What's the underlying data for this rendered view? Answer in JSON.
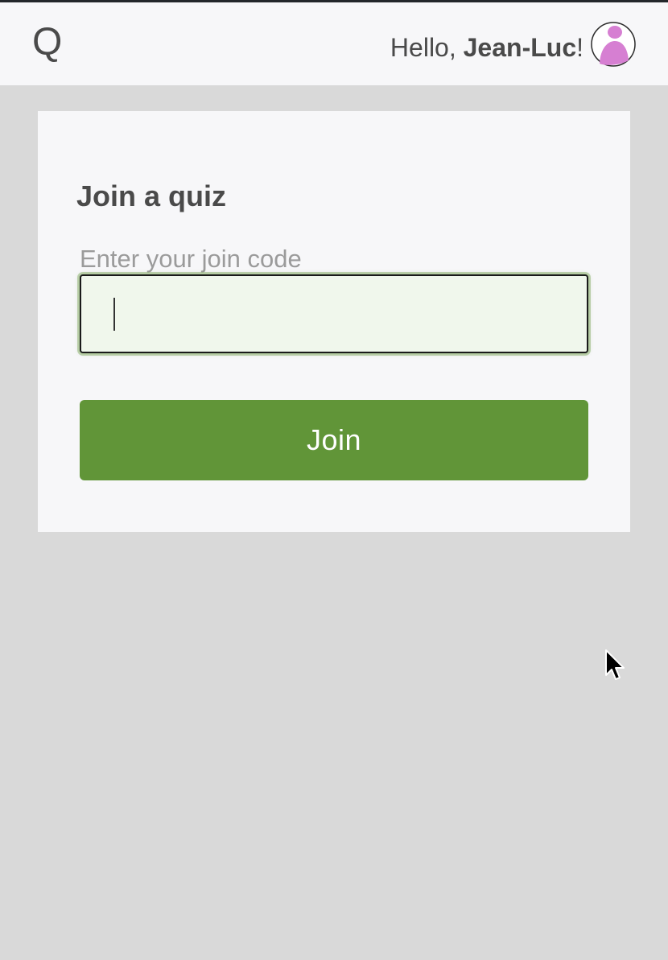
{
  "header": {
    "logo": "Q",
    "greeting_prefix": "Hello, ",
    "user_name": "Jean-Luc",
    "greeting_suffix": "!",
    "avatar_icon": "user-avatar-icon",
    "avatar_color": "#d67fd2"
  },
  "join_card": {
    "title": "Join a quiz",
    "field_label": "Enter your join code",
    "code_value": "",
    "button_label": "Join",
    "accent_color": "#619538"
  }
}
